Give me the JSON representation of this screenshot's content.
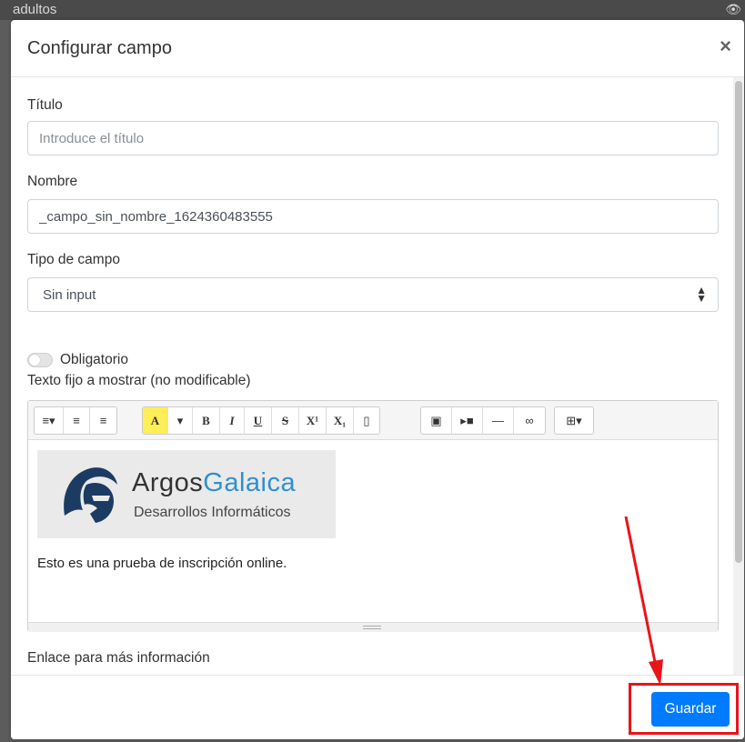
{
  "background": {
    "partial_text": "adultos",
    "eye_icon": "eye-icon"
  },
  "modal": {
    "title": "Configurar campo",
    "close_label": "×",
    "fields": {
      "title_label": "Título",
      "title_placeholder": "Introduce el título",
      "name_label": "Nombre",
      "name_value": "_campo_sin_nombre_1624360483555",
      "type_label": "Tipo de campo",
      "type_value": "Sin input",
      "required_label": "Obligatorio",
      "required_on": false,
      "fixed_text_label": "Texto fijo a mostrar (no modificable)",
      "link_label": "Enlace para más información",
      "link_value": ""
    },
    "editor": {
      "logo": {
        "name_part1": "Argos",
        "name_part2": "Galaica",
        "subtitle": "Desarrollos Informáticos"
      },
      "content": "Esto es una prueba de inscripción online."
    },
    "footer": {
      "save_label": "Guardar"
    }
  },
  "colors": {
    "primary": "#007bff",
    "annotation": "#e8141a",
    "logo_blue": "#2f8fd0",
    "logo_dark": "#1c3b63"
  },
  "icons": [
    "close-icon",
    "eye-icon",
    "select-arrow-icon",
    "align-icon",
    "bullet-list-icon",
    "numbered-list-icon",
    "highlight-icon",
    "bold-icon",
    "italic-icon",
    "underline-icon",
    "strikethrough-icon",
    "superscript-icon",
    "subscript-icon",
    "eraser-icon",
    "image-icon",
    "video-icon",
    "hr-icon",
    "link-icon",
    "table-icon"
  ]
}
